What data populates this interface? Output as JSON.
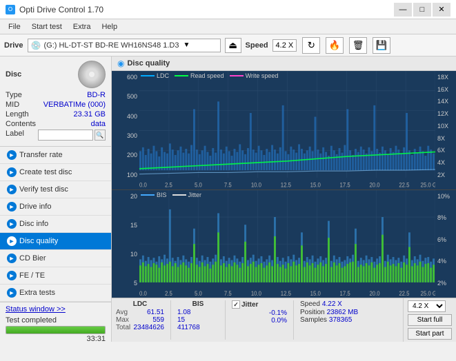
{
  "titlebar": {
    "title": "Opti Drive Control 1.70",
    "icon": "O",
    "minimize": "—",
    "maximize": "□",
    "close": "✕"
  },
  "menubar": {
    "items": [
      "File",
      "Start test",
      "Extra",
      "Help"
    ]
  },
  "drivebar": {
    "label": "Drive",
    "drive_name": "(G:) HL-DT-ST BD-RE  WH16NS48 1.D3",
    "speed_label": "Speed",
    "speed_value": "4.2 X"
  },
  "disc": {
    "title": "Disc",
    "type_label": "Type",
    "type_val": "BD-R",
    "mid_label": "MID",
    "mid_val": "VERBATIMe (000)",
    "length_label": "Length",
    "length_val": "23.31 GB",
    "contents_label": "Contents",
    "contents_val": "data",
    "label_label": "Label"
  },
  "nav": {
    "items": [
      {
        "id": "transfer-rate",
        "label": "Transfer rate",
        "icon": "►"
      },
      {
        "id": "create-test-disc",
        "label": "Create test disc",
        "icon": "►"
      },
      {
        "id": "verify-test-disc",
        "label": "Verify test disc",
        "icon": "►"
      },
      {
        "id": "drive-info",
        "label": "Drive info",
        "icon": "►"
      },
      {
        "id": "disc-info",
        "label": "Disc info",
        "icon": "►"
      },
      {
        "id": "disc-quality",
        "label": "Disc quality",
        "icon": "►",
        "active": true
      },
      {
        "id": "cd-bier",
        "label": "CD Bier",
        "icon": "►"
      },
      {
        "id": "fe-te",
        "label": "FE / TE",
        "icon": "►"
      },
      {
        "id": "extra-tests",
        "label": "Extra tests",
        "icon": "►"
      }
    ]
  },
  "status": {
    "window_btn": "Status window >>",
    "text": "Test completed",
    "progress": 100,
    "time": "33:31"
  },
  "chart": {
    "title": "Disc quality",
    "icon": "◉",
    "top": {
      "legend": [
        {
          "key": "ldc",
          "label": "LDC",
          "color": "#00aaff"
        },
        {
          "key": "read",
          "label": "Read speed",
          "color": "#00ff44"
        },
        {
          "key": "write",
          "label": "Write speed",
          "color": "#ff44cc"
        }
      ],
      "y_left": [
        "600",
        "500",
        "400",
        "300",
        "200",
        "100"
      ],
      "y_right": [
        "18X",
        "16X",
        "14X",
        "12X",
        "10X",
        "8X",
        "6X",
        "4X",
        "2X"
      ],
      "x_labels": [
        "0.0",
        "2.5",
        "5.0",
        "7.5",
        "10.0",
        "12.5",
        "15.0",
        "17.5",
        "20.0",
        "22.5",
        "25.0 GB"
      ]
    },
    "bottom": {
      "legend": [
        {
          "key": "bis",
          "label": "BIS",
          "color": "#44aaff"
        },
        {
          "key": "jitter",
          "label": "Jitter",
          "color": "#dddddd"
        }
      ],
      "y_left": [
        "20",
        "15",
        "10",
        "5"
      ],
      "y_right": [
        "10%",
        "8%",
        "6%",
        "4%",
        "2%"
      ],
      "x_labels": [
        "0.0",
        "2.5",
        "5.0",
        "7.5",
        "10.0",
        "12.5",
        "15.0",
        "17.5",
        "20.0",
        "22.5",
        "25.0 GB"
      ]
    }
  },
  "stats": {
    "ldc_label": "LDC",
    "bis_label": "BIS",
    "jitter_label": "Jitter",
    "speed_label": "Speed",
    "avg_label": "Avg",
    "max_label": "Max",
    "total_label": "Total",
    "ldc_avg": "61.51",
    "ldc_max": "559",
    "ldc_total": "23484626",
    "bis_avg": "1.08",
    "bis_max": "15",
    "bis_total": "411768",
    "jitter_avg": "-0.1%",
    "jitter_max": "0.0%",
    "jitter_total": "",
    "speed_val": "4.22 X",
    "position_label": "Position",
    "position_val": "23862 MB",
    "samples_label": "Samples",
    "samples_val": "378365",
    "speed_dropdown": "4.2 X",
    "start_full": "Start full",
    "start_part": "Start part"
  }
}
